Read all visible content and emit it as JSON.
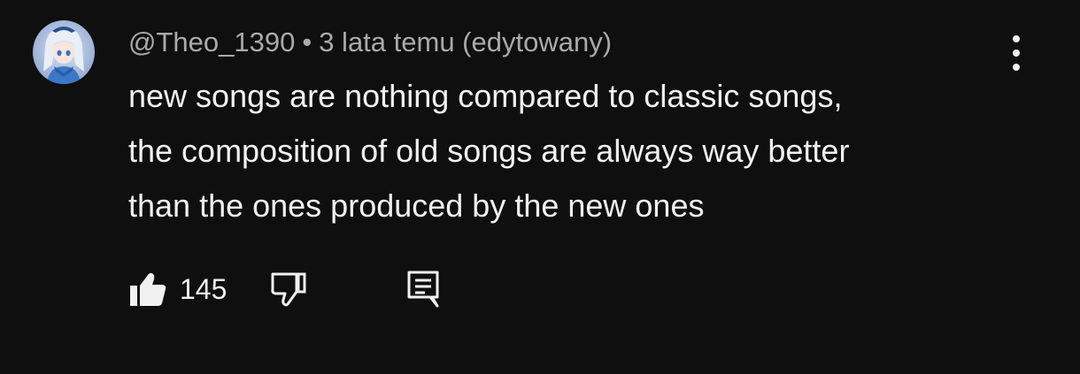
{
  "comment": {
    "author": "@Theo_1390",
    "separator": "•",
    "timestamp": "3 lata temu (edytowany)",
    "text_lines": [
      "new songs are nothing compared to classic songs,",
      "the composition of old songs are always way better",
      "than the ones produced by the new ones"
    ],
    "like_count": "145"
  },
  "icons": {
    "avatar": "avatar-image",
    "more": "more-vert-icon",
    "like": "thumbs-up-filled-icon",
    "dislike": "thumbs-down-outline-icon",
    "reply": "comment-reply-icon"
  },
  "colors": {
    "background": "#0f0f0f",
    "primary_text": "#f1f1f1",
    "secondary_text": "#aaaaaa"
  }
}
